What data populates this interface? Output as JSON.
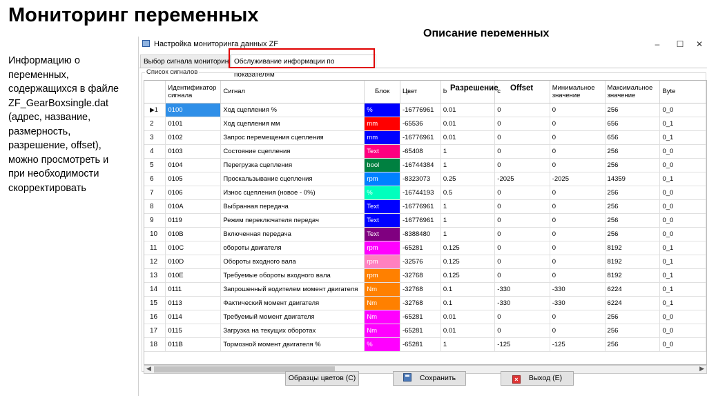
{
  "slide": {
    "title": "Мониторинг переменных",
    "description_heading": "Описание переменных",
    "info_lines": [
      "Информацию о",
      "переменных,",
      "содержащихся в файле",
      "ZF_GearBoxsingle.dat",
      "(адрес, название,",
      "размерность,",
      "разрешение, offset),",
      "можно просмотреть и",
      "при необходимости",
      "скорректировать"
    ]
  },
  "window": {
    "title": "Настройка мониторинга данных ZF",
    "minimize": "–",
    "maximize": "☐",
    "close": "✕"
  },
  "tabs": [
    {
      "label": "Выбор сигнала мониторинга"
    },
    {
      "label": "Обслуживание информации по показателям"
    }
  ],
  "group_label": "Список сигналов",
  "overlay_labels": {
    "resolution": "Разрешение",
    "offset": "Offset"
  },
  "table": {
    "headers": [
      "",
      "Идентификатор сигнала",
      "Сигнал",
      "Блок",
      "Цвет",
      "b",
      "c",
      "Минимальное значение",
      "Максимальное значение",
      "Byte"
    ],
    "rows": [
      {
        "n": "1",
        "id": "0100",
        "name": "Ход сцепления %",
        "unit": "%",
        "bg": "#0000ff",
        "color": "-16776961",
        "b": "0.01",
        "c": "0",
        "min": "0",
        "max": "256",
        "byte": "0_0"
      },
      {
        "n": "2",
        "id": "0101",
        "name": "Ход сцепления мм",
        "unit": "mm",
        "bg": "#ff0000",
        "color": "-65536",
        "b": "0.01",
        "c": "0",
        "min": "0",
        "max": "656",
        "byte": "0_1"
      },
      {
        "n": "3",
        "id": "0102",
        "name": "Запрос перемещения сцепления",
        "unit": "mm",
        "bg": "#0000ff",
        "color": "-16776961",
        "b": "0.01",
        "c": "0",
        "min": "0",
        "max": "656",
        "byte": "0_1"
      },
      {
        "n": "4",
        "id": "0103",
        "name": "Состояние сцепления",
        "unit": "Text",
        "bg": "#ff0080",
        "color": "-65408",
        "b": "1",
        "c": "0",
        "min": "0",
        "max": "256",
        "byte": "0_0"
      },
      {
        "n": "5",
        "id": "0104",
        "name": "Перегрузка сцепления",
        "unit": "bool",
        "bg": "#008040",
        "color": "-16744384",
        "b": "1",
        "c": "0",
        "min": "0",
        "max": "256",
        "byte": "0_0"
      },
      {
        "n": "6",
        "id": "0105",
        "name": "Проскальзывание сцепления",
        "unit": "rpm",
        "bg": "#0080ff",
        "color": "-8323073",
        "b": "0.25",
        "c": "-2025",
        "min": "-2025",
        "max": "14359",
        "byte": "0_1"
      },
      {
        "n": "7",
        "id": "0106",
        "name": "Износ сцепления (новое - 0%)",
        "unit": "%",
        "bg": "#00ffbd",
        "color": "-16744193",
        "b": "0.5",
        "c": "0",
        "min": "0",
        "max": "256",
        "byte": "0_0"
      },
      {
        "n": "8",
        "id": "010A",
        "name": "Выбранная передача",
        "unit": "Text",
        "bg": "#0000ff",
        "color": "-16776961",
        "b": "1",
        "c": "0",
        "min": "0",
        "max": "256",
        "byte": "0_0"
      },
      {
        "n": "9",
        "id": "0119",
        "name": "Режим переключателя передач",
        "unit": "Text",
        "bg": "#0000ff",
        "color": "-16776961",
        "b": "1",
        "c": "0",
        "min": "0",
        "max": "256",
        "byte": "0_0"
      },
      {
        "n": "10",
        "id": "010B",
        "name": "Включенная передача",
        "unit": "Text",
        "bg": "#800080",
        "color": "-8388480",
        "b": "1",
        "c": "0",
        "min": "0",
        "max": "256",
        "byte": "0_0"
      },
      {
        "n": "11",
        "id": "010C",
        "name": "обороты двигателя",
        "unit": "rpm",
        "bg": "#ff00ff",
        "color": "-65281",
        "b": "0.125",
        "c": "0",
        "min": "0",
        "max": "8192",
        "byte": "0_1"
      },
      {
        "n": "12",
        "id": "010D",
        "name": "Обороты входного вала",
        "unit": "rpm",
        "bg": "#ff80c0",
        "color": "-32576",
        "b": "0.125",
        "c": "0",
        "min": "0",
        "max": "8192",
        "byte": "0_1"
      },
      {
        "n": "13",
        "id": "010E",
        "name": "Требуемые обороты входного вала",
        "unit": "rpm",
        "bg": "#ff8000",
        "color": "-32768",
        "b": "0.125",
        "c": "0",
        "min": "0",
        "max": "8192",
        "byte": "0_1"
      },
      {
        "n": "14",
        "id": "0111",
        "name": "Запрошенный водителем момент двигателя",
        "unit": "Nm",
        "bg": "#ff8000",
        "color": "-32768",
        "b": "0.1",
        "c": "-330",
        "min": "-330",
        "max": "6224",
        "byte": "0_1"
      },
      {
        "n": "15",
        "id": "0113",
        "name": "Фактический момент двигателя",
        "unit": "Nm",
        "bg": "#ff8000",
        "color": "-32768",
        "b": "0.1",
        "c": "-330",
        "min": "-330",
        "max": "6224",
        "byte": "0_1"
      },
      {
        "n": "16",
        "id": "0114",
        "name": "Требуемый момент двигателя",
        "unit": "Nm",
        "bg": "#ff00ff",
        "color": "-65281",
        "b": "0.01",
        "c": "0",
        "min": "0",
        "max": "256",
        "byte": "0_0"
      },
      {
        "n": "17",
        "id": "0115",
        "name": "Загрузка на текущих оборотах",
        "unit": "Nm",
        "bg": "#ff00ff",
        "color": "-65281",
        "b": "0.01",
        "c": "0",
        "min": "0",
        "max": "256",
        "byte": "0_0"
      },
      {
        "n": "18",
        "id": "011B",
        "name": "Тормозной момент двигателя %",
        "unit": "%",
        "bg": "#ff00ff",
        "color": "-65281",
        "b": "1",
        "c": "-125",
        "min": "-125",
        "max": "256",
        "byte": "0_0"
      }
    ]
  },
  "buttons": {
    "color_samples": "Образцы цветов (C)",
    "save": "Сохранить",
    "exit": "Выход (E)"
  }
}
